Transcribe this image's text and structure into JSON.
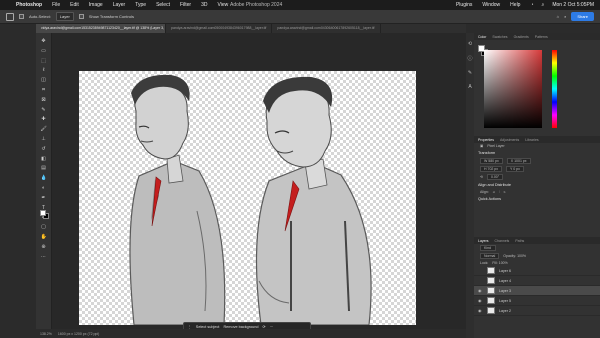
{
  "menubar": {
    "app_name": "Photoshop",
    "items": [
      "File",
      "Edit",
      "Image",
      "Layer",
      "Type",
      "Select",
      "Filter",
      "3D",
      "View"
    ],
    "right_items": [
      "Plugins",
      "Window",
      "Help"
    ],
    "clock": "Mon 2 Oct 5:05PM"
  },
  "window_title": "Adobe Photoshop 2024",
  "options": {
    "auto_select": "Auto-Select:",
    "auto_select_target": "Layer",
    "show_transform": "Show Transform Controls",
    "share_label": "Share"
  },
  "tabs": [
    {
      "label": "vidya.aravind@gmail.com15315238949871123420__layer.tif @ 138% (Layer 3, RGB/8#)",
      "active": true
    },
    {
      "label": "pandya.aravind@gmail.com0500049384396017988__layer.tif",
      "active": false
    },
    {
      "label": "pandya.aravind@gmail.com04306400617892605118__layer.tif",
      "active": false
    }
  ],
  "context_bar": {
    "select_subject": "Select subject",
    "remove_background": "Remove background"
  },
  "status": {
    "zoom": "138.2%",
    "info": "1600 px x 1200 px (72 ppi)"
  },
  "color_tabs": [
    "Color",
    "Swatches",
    "Gradients",
    "Patterns"
  ],
  "properties": {
    "tabs": [
      "Properties",
      "Adjustments",
      "Libraries"
    ],
    "layer_kind": "Pixel Layer",
    "transform_title": "Transform",
    "w": "W 580 px",
    "h": "H 702 px",
    "x": "X 1001 px",
    "y": "Y 0 px",
    "angle": "0.00°",
    "align_title": "Align and Distribute",
    "align_label": "Align:",
    "quick_actions": "Quick Actions"
  },
  "layers_panel": {
    "tabs": [
      "Layers",
      "Channels",
      "Paths"
    ],
    "kind": "Kind",
    "blend_mode": "Normal",
    "opacity": "Opacity: 100%",
    "fill": "Fill: 100%",
    "lock": "Lock:",
    "rows": [
      {
        "name": "Layer 6",
        "visible": false,
        "selected": false
      },
      {
        "name": "Layer 4",
        "visible": false,
        "selected": false
      },
      {
        "name": "Layer 3",
        "visible": true,
        "selected": true
      },
      {
        "name": "Layer 5",
        "visible": true,
        "selected": false
      },
      {
        "name": "Layer 2",
        "visible": true,
        "selected": false
      }
    ]
  },
  "colors": {
    "accent": "#2d7be5",
    "shirt_red": "#c41e1e",
    "suit_grey": "#b5b5b5"
  }
}
